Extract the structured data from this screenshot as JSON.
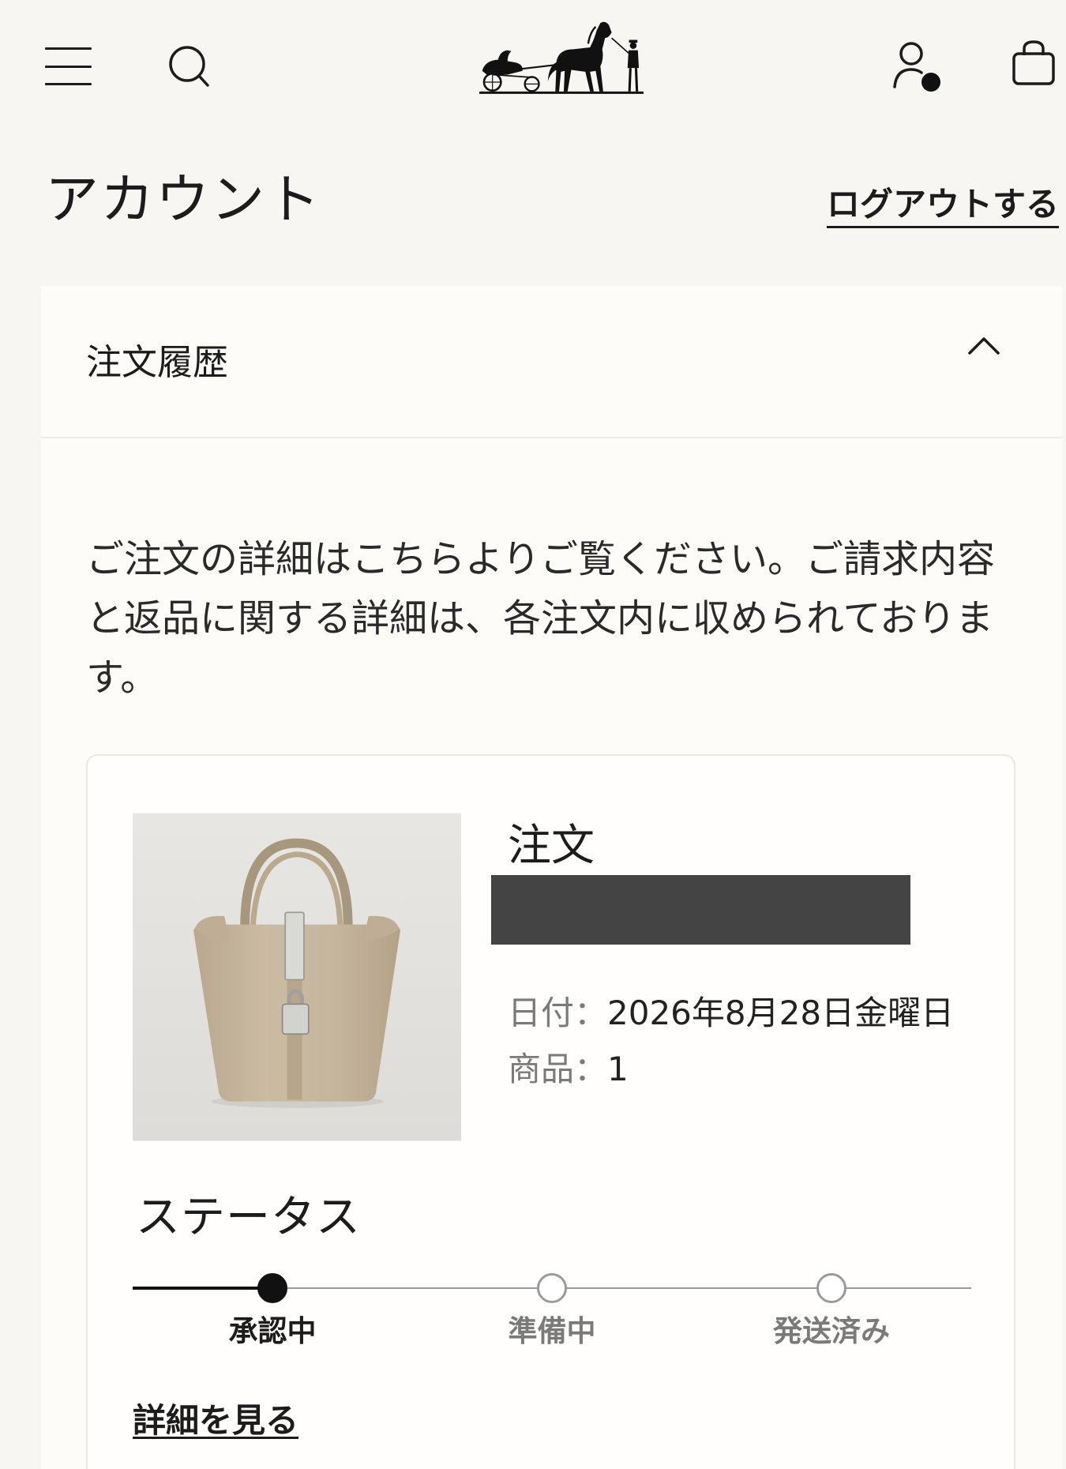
{
  "header": {
    "menu_icon": "hamburger-menu-icon",
    "search_icon": "search-icon",
    "logo": "carriage-logo",
    "account_icon": "user-account-icon",
    "cart_icon": "shopping-bag-icon"
  },
  "account": {
    "title": "アカウント",
    "logout_label": "ログアウトする"
  },
  "order_history": {
    "section_label": "注文履歴",
    "expanded": true,
    "toggle_icon": "chevron-up-icon",
    "intro_text": "ご注文の詳細はこちらよりご覧ください。ご請求内容と返品に関する詳細は、各注文内に収められております。",
    "order": {
      "title": "注文",
      "date_label": "日付：",
      "date_value": "2026年8月28日金曜日",
      "items_label": "商品：",
      "items_value": "1",
      "status_heading": "ステータス",
      "current_step": 0,
      "steps": [
        {
          "label": "承認中",
          "state": "current"
        },
        {
          "label": "準備中",
          "state": "pending"
        },
        {
          "label": "発送済み",
          "state": "pending"
        }
      ],
      "details_link_label": "詳細を見る"
    }
  },
  "colors": {
    "background": "#f8f6f2",
    "panel": "#fdfcf9",
    "text": "#1c1c1c",
    "muted": "#7a7a7a",
    "redaction": "#444444",
    "status_active": "#111111",
    "status_inactive": "#9a9a9a"
  }
}
